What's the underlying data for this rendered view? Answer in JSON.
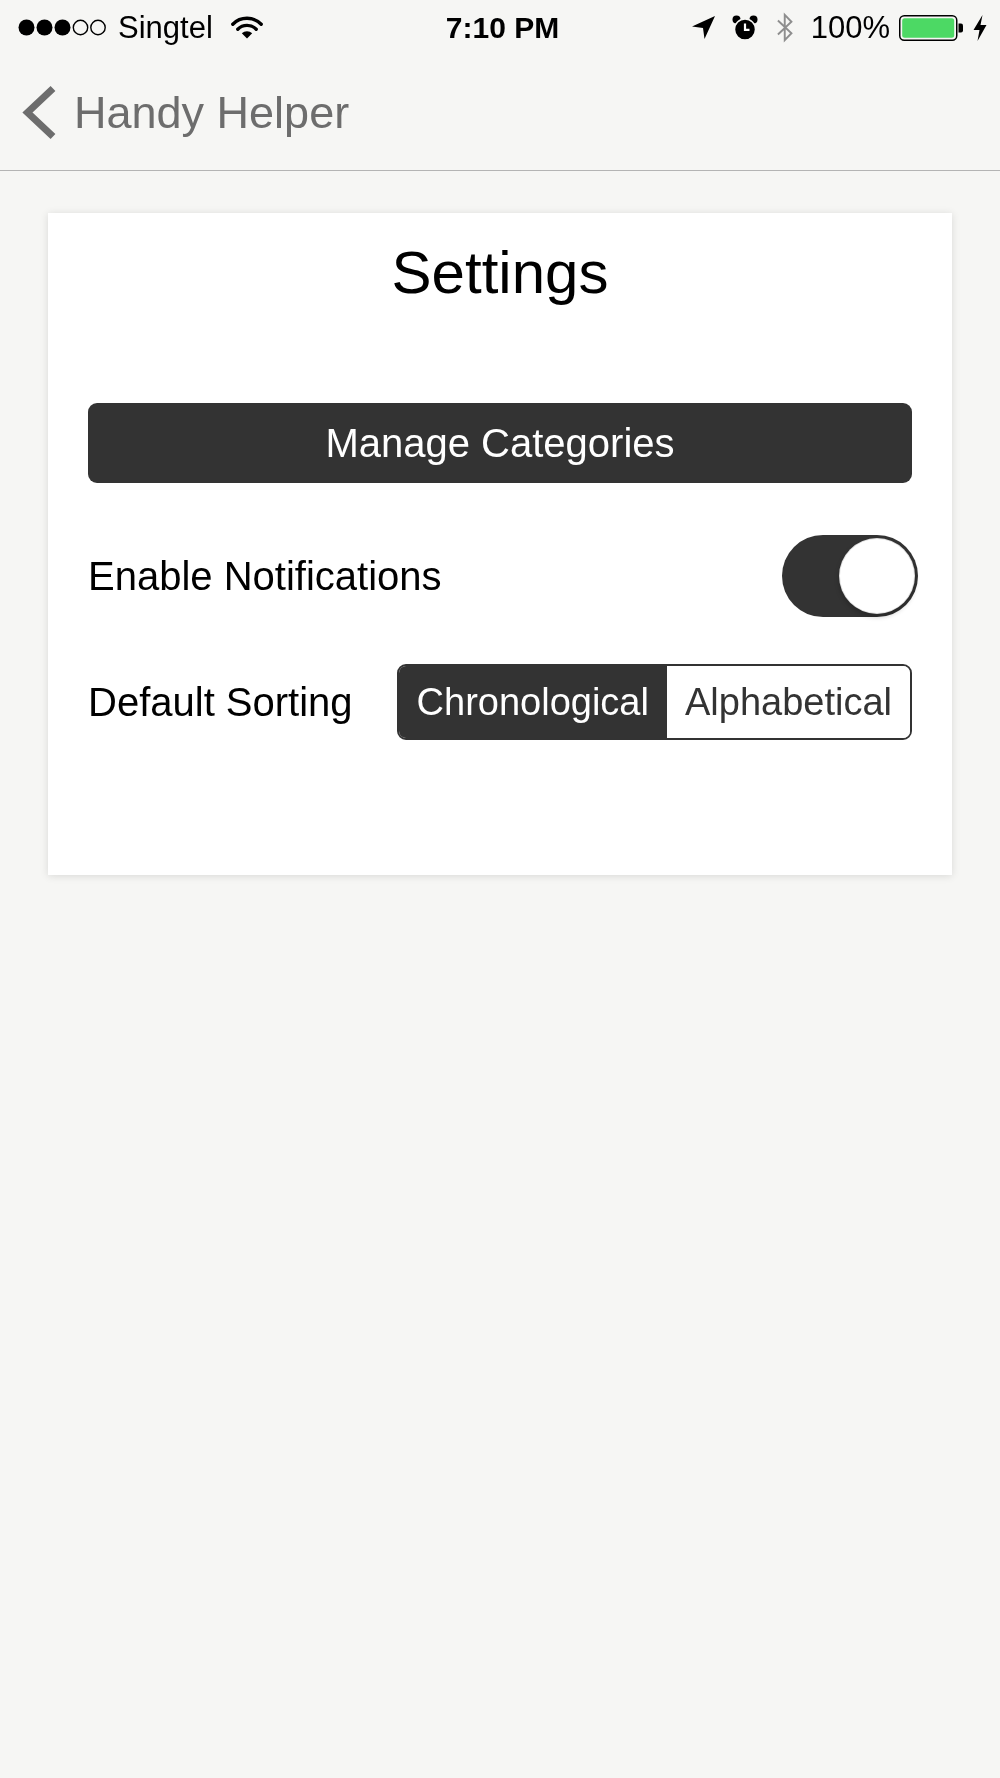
{
  "status_bar": {
    "carrier": "Singtel",
    "time": "7:10 PM",
    "battery_percent": "100%"
  },
  "nav_bar": {
    "back_label": "Handy Helper"
  },
  "settings_card": {
    "title": "Settings",
    "button": "Manage Categories",
    "rows": [
      {
        "kind": "toggle",
        "label": "Enable Notifications",
        "on": true
      },
      {
        "kind": "segmented",
        "label": "Default Sorting",
        "options": [
          {
            "label": "Chronological",
            "selected": true
          },
          {
            "label": "Alphabetical",
            "selected": false
          }
        ]
      }
    ]
  }
}
